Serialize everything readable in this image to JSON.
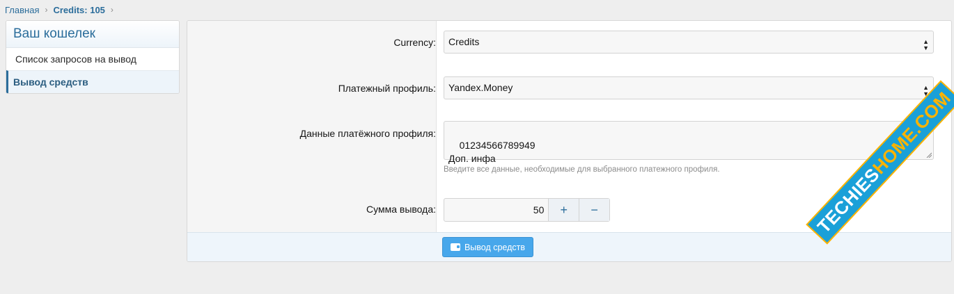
{
  "breadcrumb": {
    "home": "Главная",
    "current": "Credits: 105"
  },
  "sidebar": {
    "title": "Ваш кошелек",
    "items": [
      {
        "label": "Список запросов на вывод"
      },
      {
        "label": "Вывод средств"
      }
    ]
  },
  "form": {
    "currency_label": "Currency:",
    "currency_value": "Credits",
    "profile_label": "Платежный профиль:",
    "profile_value": "Yandex.Money",
    "profile_data_label": "Данные платёжного профиля:",
    "profile_data_value": "01234566789949\nДоп. инфа",
    "profile_data_hint": "Введите все данные, необходимые для выбранного платежного профиля.",
    "amount_label": "Сумма вывода:",
    "amount_value": "50",
    "plus": "+",
    "minus": "−",
    "submit_label": "Вывод средств"
  },
  "watermark": {
    "text_a": "TECHIES",
    "text_b": "HOME.COM"
  },
  "colors": {
    "accent": "#2b6d9b",
    "button": "#47a7eb",
    "watermark": "#1aa0d8"
  }
}
